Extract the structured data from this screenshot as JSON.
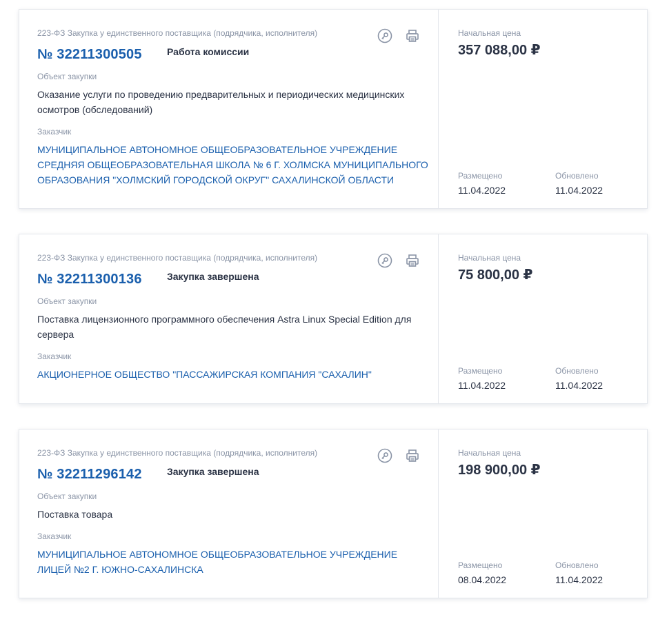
{
  "colors": {
    "accent": "#1a5fad",
    "muted": "#8a94a6",
    "text": "#2b3345",
    "icon": "#8a94a6"
  },
  "cards": [
    {
      "law": "223-ФЗ Закупка у единственного поставщика (подрядчика, исполнителя)",
      "number": "№ 32211300505",
      "status": "Работа комиссии",
      "object_label": "Объект закупки",
      "object_text": "Оказание услуги по проведению предварительных и периодических медицинских осмотров (обследований)",
      "customer_label": "Заказчик",
      "customer": "МУНИЦИПАЛЬНОЕ АВТОНОМНОЕ ОБЩЕОБРАЗОВАТЕЛЬНОЕ УЧРЕЖДЕНИЕ СРЕДНЯЯ ОБЩЕОБРАЗОВАТЕЛЬНАЯ ШКОЛА № 6 Г. ХОЛМСКА МУНИЦИПАЛЬНОГО ОБРАЗОВАНИЯ \"ХОЛМСКИЙ ГОРОДСКОЙ ОКРУГ\" САХАЛИНСКОЙ ОБЛАСТИ",
      "price_label": "Начальная цена",
      "price": "357 088,00 ₽",
      "posted_label": "Размещено",
      "posted": "11.04.2022",
      "updated_label": "Обновлено",
      "updated": "11.04.2022",
      "icons": [
        "key-icon",
        "print-icon"
      ]
    },
    {
      "law": "223-ФЗ Закупка у единственного поставщика (подрядчика, исполнителя)",
      "number": "№ 32211300136",
      "status": "Закупка завершена",
      "object_label": "Объект закупки",
      "object_text": "Поставка лицензионного программного обеспечения Astra Linux Special Edition для сервера",
      "customer_label": "Заказчик",
      "customer": "АКЦИОНЕРНОЕ ОБЩЕСТВО \"ПАССАЖИРСКАЯ КОМПАНИЯ \"САХАЛИН\"",
      "price_label": "Начальная цена",
      "price": "75 800,00 ₽",
      "posted_label": "Размещено",
      "posted": "11.04.2022",
      "updated_label": "Обновлено",
      "updated": "11.04.2022",
      "icons": [
        "key-icon",
        "print-icon"
      ]
    },
    {
      "law": "223-ФЗ Закупка у единственного поставщика (подрядчика, исполнителя)",
      "number": "№ 32211296142",
      "status": "Закупка завершена",
      "object_label": "Объект закупки",
      "object_text": "Поставка товара",
      "customer_label": "Заказчик",
      "customer": "МУНИЦИПАЛЬНОЕ АВТОНОМНОЕ ОБЩЕОБРАЗОВАТЕЛЬНОЕ УЧРЕЖДЕНИЕ ЛИЦЕЙ №2 Г. ЮЖНО-САХАЛИНСКА",
      "price_label": "Начальная цена",
      "price": "198 900,00 ₽",
      "posted_label": "Размещено",
      "posted": "08.04.2022",
      "updated_label": "Обновлено",
      "updated": "11.04.2022",
      "icons": [
        "key-icon",
        "print-icon"
      ]
    }
  ]
}
